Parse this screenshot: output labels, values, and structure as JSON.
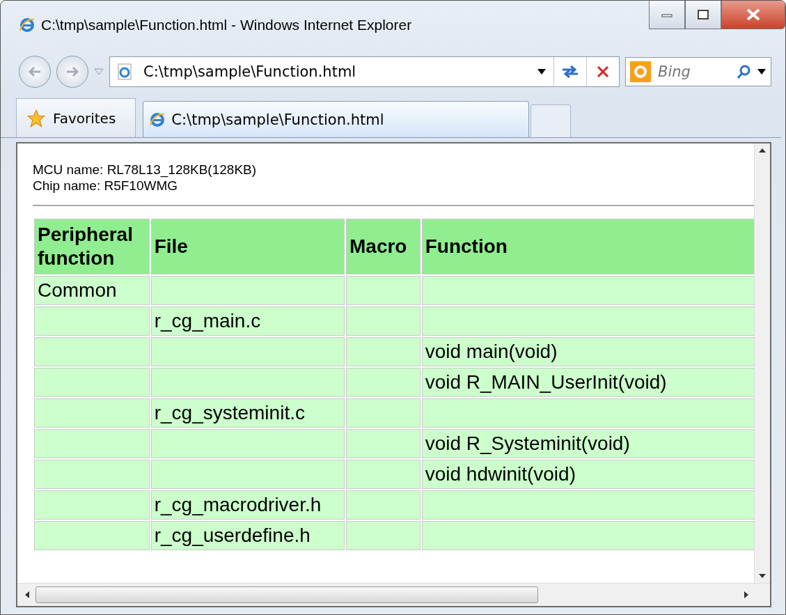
{
  "window": {
    "title": "C:\\tmp\\sample\\Function.html - Windows Internet Explorer"
  },
  "address_bar": {
    "value": "C:\\tmp\\sample\\Function.html"
  },
  "search": {
    "placeholder": "Bing"
  },
  "favorites": {
    "label": "Favorites"
  },
  "tabs": [
    {
      "label": "C:\\tmp\\sample\\Function.html",
      "selected": true
    }
  ],
  "page": {
    "lines": [
      "MCU name: RL78L13_128KB(128KB)",
      "Chip name: R5F10WMG"
    ],
    "table": {
      "columns": [
        "Peripheral function",
        "File",
        "Macro",
        "Function"
      ],
      "rows": [
        [
          "Common",
          "",
          "",
          ""
        ],
        [
          "",
          "r_cg_main.c",
          "",
          ""
        ],
        [
          "",
          "",
          "",
          "void main(void)"
        ],
        [
          "",
          "",
          "",
          "void R_MAIN_UserInit(void)"
        ],
        [
          "",
          "r_cg_systeminit.c",
          "",
          ""
        ],
        [
          "",
          "",
          "",
          "void R_Systeminit(void)"
        ],
        [
          "",
          "",
          "",
          "void hdwinit(void)"
        ],
        [
          "",
          "r_cg_macrodriver.h",
          "",
          ""
        ],
        [
          "",
          "r_cg_userdefine.h",
          "",
          ""
        ]
      ]
    }
  }
}
